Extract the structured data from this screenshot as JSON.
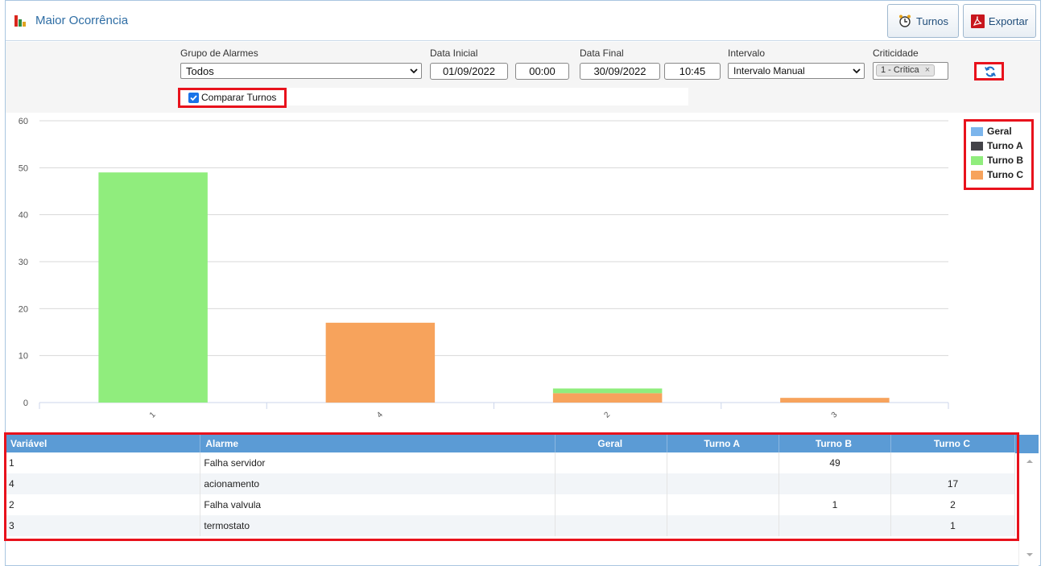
{
  "header": {
    "title": "Maior Ocorrência",
    "turnos_label": "Turnos",
    "exportar_label": "Exportar"
  },
  "filters": {
    "grupo_label": "Grupo de Alarmes",
    "grupo_value": "Todos",
    "data_inicial_label": "Data Inicial",
    "data_inicial_date": "01/09/2022",
    "data_inicial_time": "00:00",
    "data_final_label": "Data Final",
    "data_final_date": "30/09/2022",
    "data_final_time": "10:45",
    "intervalo_label": "Intervalo",
    "intervalo_value": "Intervalo Manual",
    "criticidade_label": "Criticidade",
    "criticidade_chip": "1 - Crítica",
    "chip_remove": "×",
    "comparar_label": "Comparar Turnos",
    "comparar_checked": true
  },
  "chart_data": {
    "type": "bar",
    "categories": [
      "1",
      "4",
      "2",
      "3"
    ],
    "series": [
      {
        "name": "Geral",
        "color": "#7cb5ec",
        "values": [
          0,
          0,
          0,
          0
        ]
      },
      {
        "name": "Turno A",
        "color": "#434348",
        "values": [
          0,
          0,
          0,
          0
        ]
      },
      {
        "name": "Turno B",
        "color": "#90ed7d",
        "values": [
          49,
          0,
          1,
          0
        ]
      },
      {
        "name": "Turno C",
        "color": "#f7a35c",
        "values": [
          0,
          17,
          2,
          1
        ]
      }
    ],
    "stacked": true,
    "ylim": [
      0,
      60
    ],
    "yticks": [
      "60",
      "50",
      "40",
      "30",
      "20",
      "10",
      "0"
    ],
    "legend_position": "top-right",
    "grid": true
  },
  "table": {
    "headers": [
      "Variável",
      "Alarme",
      "Geral",
      "Turno A",
      "Turno B",
      "Turno C"
    ],
    "rows": [
      [
        "1",
        "Falha servidor",
        "",
        "",
        "49",
        ""
      ],
      [
        "4",
        "acionamento",
        "",
        "",
        "",
        "17"
      ],
      [
        "2",
        "Falha valvula",
        "",
        "",
        "1",
        "2"
      ],
      [
        "3",
        "termostato",
        "",
        "",
        "",
        "1"
      ]
    ]
  }
}
